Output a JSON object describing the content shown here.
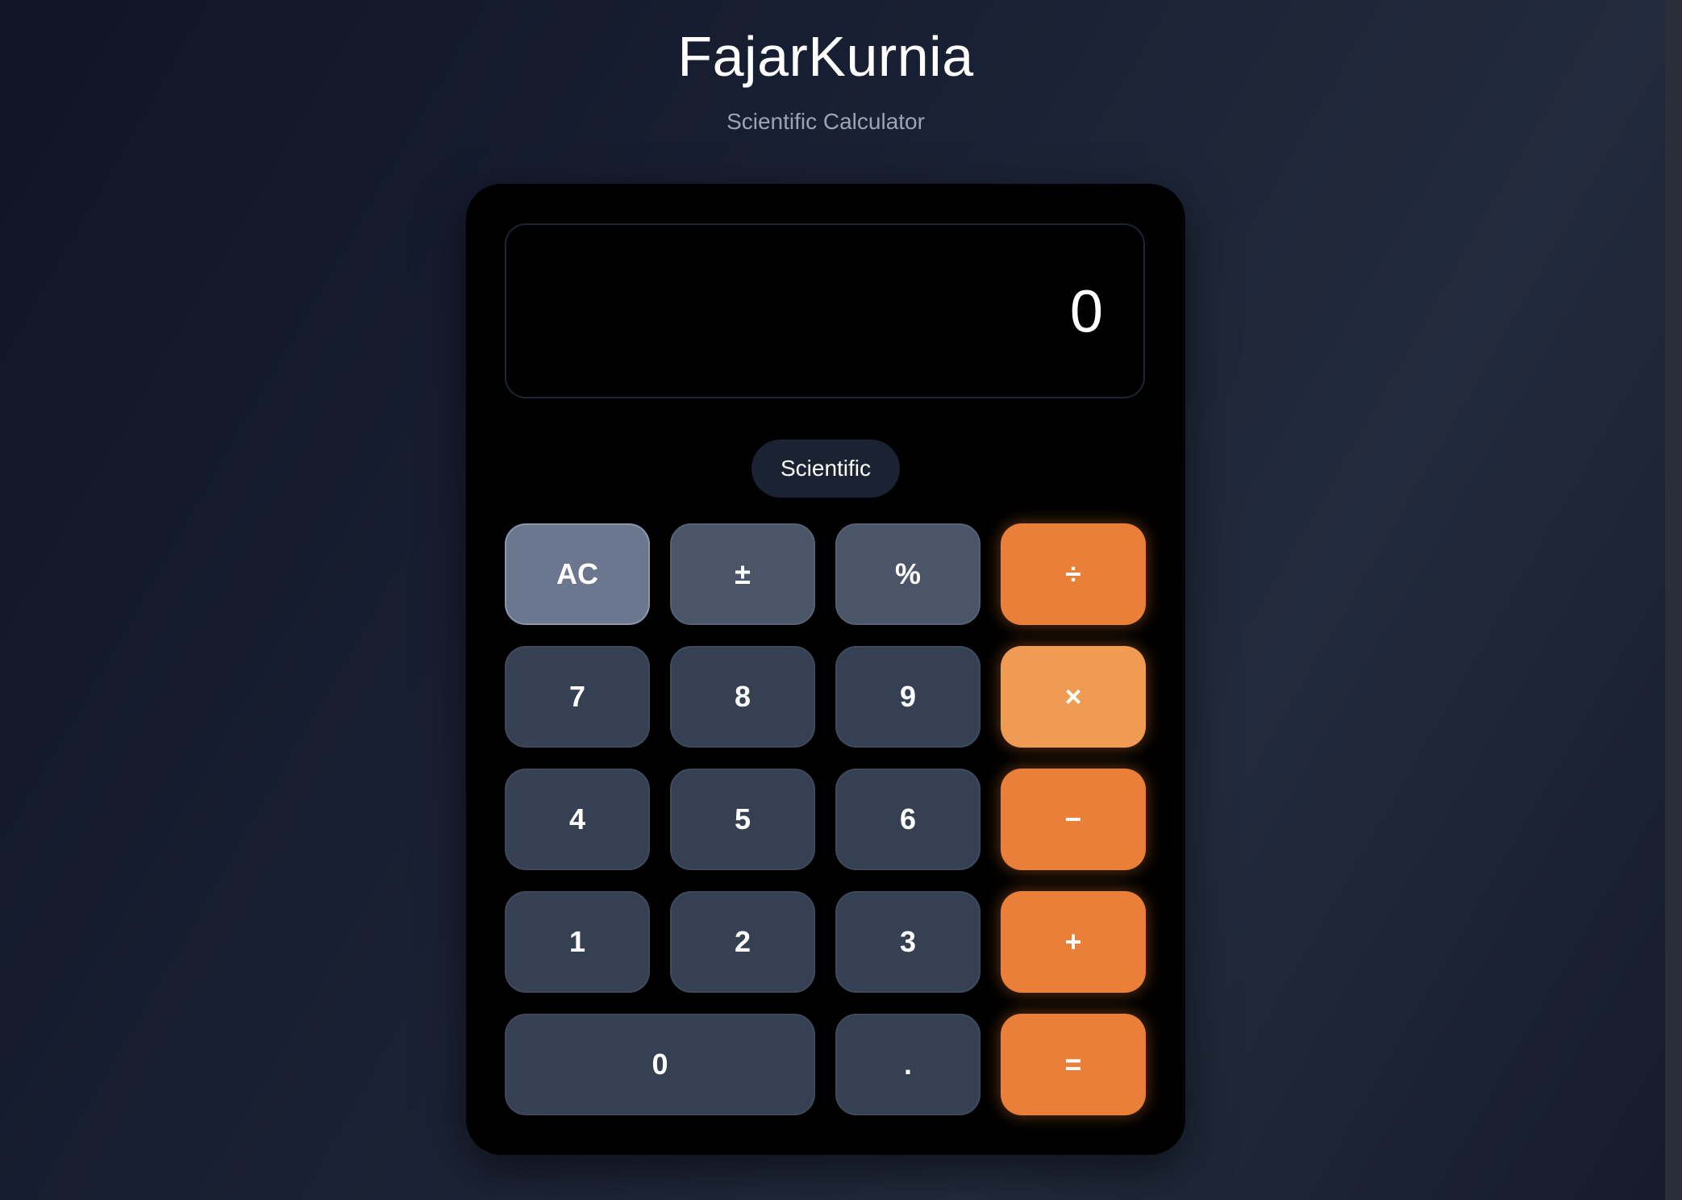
{
  "header": {
    "title": "FajarKurnia",
    "subtitle": "Scientific Calculator"
  },
  "display": {
    "value": "0"
  },
  "mode_toggle": {
    "label": "Scientific"
  },
  "keys": {
    "ac": "AC",
    "plus_minus": "±",
    "percent": "%",
    "divide": "÷",
    "seven": "7",
    "eight": "8",
    "nine": "9",
    "multiply": "×",
    "four": "4",
    "five": "5",
    "six": "6",
    "minus": "−",
    "one": "1",
    "two": "2",
    "three": "3",
    "plus": "+",
    "zero": "0",
    "decimal": ".",
    "equals": "="
  },
  "colors": {
    "operator": "#e97f38",
    "operator_active": "#ef9b53",
    "number_key": "#354052",
    "function_key": "#4a5567",
    "clear_key": "#6a778e"
  }
}
